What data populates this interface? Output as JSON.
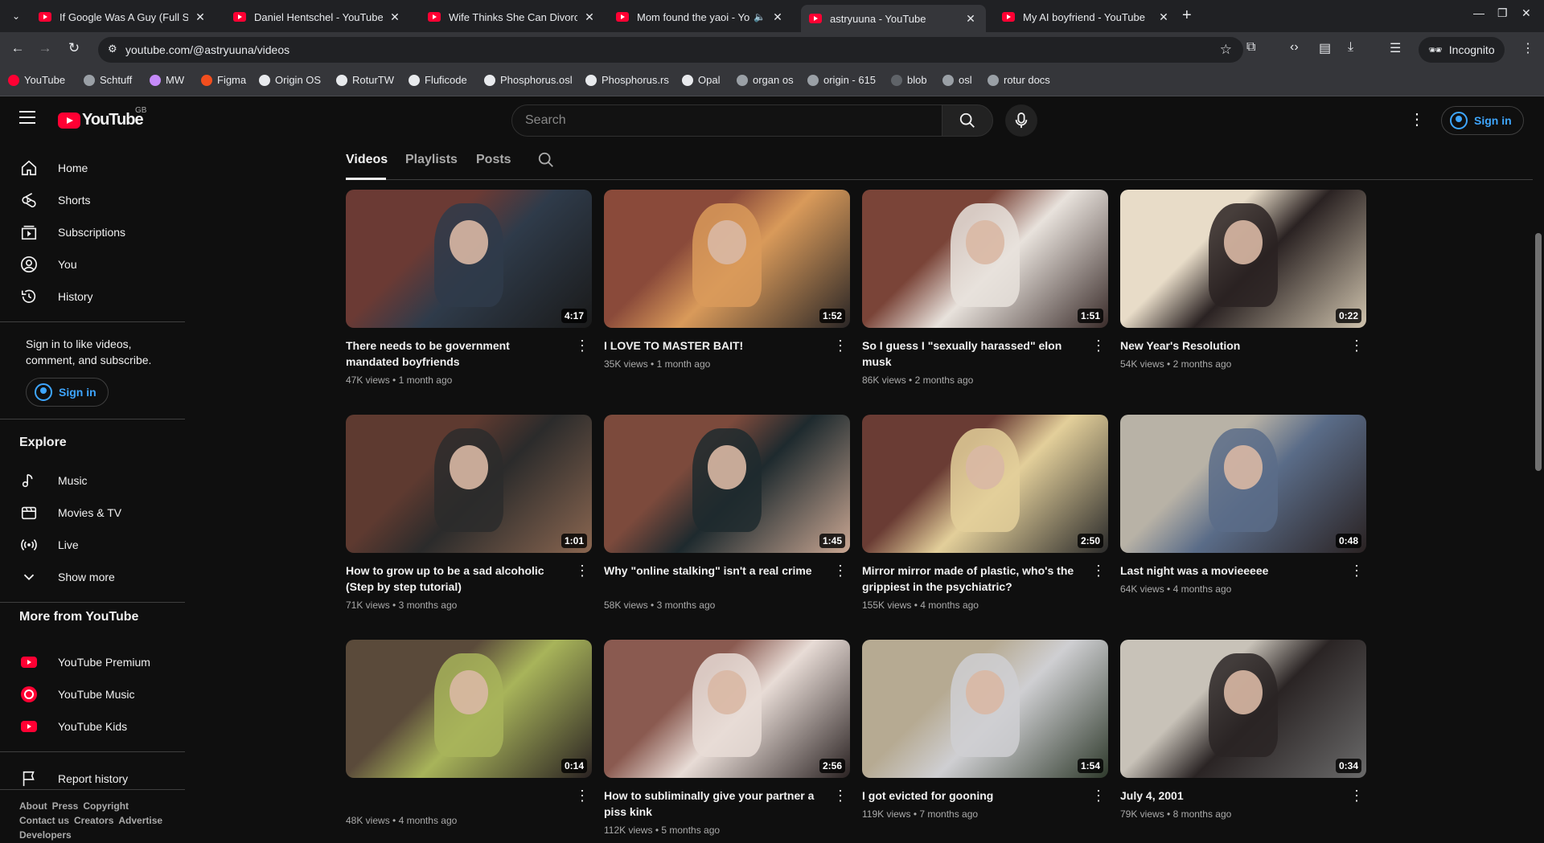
{
  "browser": {
    "tabs": [
      {
        "title": "If Google Was A Guy (Full Se",
        "active": false
      },
      {
        "title": "Daniel Hentschel - YouTube",
        "active": false
      },
      {
        "title": "Wife Thinks She Can Divorce",
        "active": false
      },
      {
        "title": "Mom found the yaoi - You",
        "active": false,
        "audio": "🔈"
      },
      {
        "title": "astryuuna - YouTube",
        "active": true
      },
      {
        "title": "My AI boyfriend - YouTube",
        "active": false
      }
    ],
    "tab_close": "✕",
    "new_tab": "+",
    "url": "youtube.com/@astryuuna/videos",
    "incognito_label": "Incognito",
    "bookmarks": [
      {
        "label": "YouTube",
        "color": "#ff0033"
      },
      {
        "label": "Schtuff",
        "color": "#9aa0a6"
      },
      {
        "label": "MW",
        "color": "#c58af9"
      },
      {
        "label": "Figma",
        "color": "#f24e1e"
      },
      {
        "label": "Origin OS",
        "color": "#e8eaed"
      },
      {
        "label": "RoturTW",
        "color": "#e8eaed"
      },
      {
        "label": "Fluficode",
        "color": "#e8eaed"
      },
      {
        "label": "Phosphorus.osl",
        "color": "#e8eaed"
      },
      {
        "label": "Phosphorus.rs",
        "color": "#e8eaed"
      },
      {
        "label": "Opal",
        "color": "#e8eaed"
      },
      {
        "label": "organ os",
        "color": "#9aa0a6"
      },
      {
        "label": "origin - 615",
        "color": "#9aa0a6"
      },
      {
        "label": "blob",
        "color": "#5f6368"
      },
      {
        "label": "osl",
        "color": "#9aa0a6"
      },
      {
        "label": "rotur docs",
        "color": "#9aa0a6"
      }
    ]
  },
  "youtube": {
    "logo_text": "YouTube",
    "region": "GB",
    "search_placeholder": "Search",
    "signin_label": "Sign in",
    "sidebar": {
      "main": [
        "Home",
        "Shorts",
        "Subscriptions",
        "You",
        "History"
      ],
      "signin_message": "Sign in to like videos, comment, and subscribe.",
      "signin_label": "Sign in",
      "explore_heading": "Explore",
      "explore": [
        "Music",
        "Movies & TV",
        "Live",
        "Show more"
      ],
      "more_heading": "More from YouTube",
      "more": [
        "YouTube Premium",
        "YouTube Music",
        "YouTube Kids"
      ],
      "report": "Report history",
      "footer1": [
        "About",
        "Press",
        "Copyright"
      ],
      "footer2": [
        "Contact us",
        "Creators",
        "Advertise"
      ],
      "footer3": [
        "Developers"
      ]
    },
    "channel_tabs": [
      "Videos",
      "Playlists",
      "Posts"
    ],
    "videos": [
      {
        "title": "There needs to be government mandated boyfriends",
        "views": "47K views",
        "age": "1 month ago",
        "duration": "4:17",
        "colors": [
          "#6b3a34",
          "#2f3b4a",
          "#1a1a1a"
        ]
      },
      {
        "title": "I LOVE TO MASTER BAIT!",
        "views": "35K views",
        "age": "1 month ago",
        "duration": "1:52",
        "colors": [
          "#8a4a3a",
          "#d99a5a",
          "#2a2626"
        ]
      },
      {
        "title": "So I guess I \"sexually harassed\" elon musk",
        "views": "86K views",
        "age": "2 months ago",
        "duration": "1:51",
        "colors": [
          "#7a4438",
          "#e8e2dc",
          "#3a2c2a"
        ]
      },
      {
        "title": "New Year's Resolution",
        "views": "54K views",
        "age": "2 months ago",
        "duration": "0:22",
        "colors": [
          "#e8dcc8",
          "#2a2222",
          "#cfc3ad"
        ]
      },
      {
        "title": "How to grow up to be a sad alcoholic (Step by step tutorial)",
        "views": "71K views",
        "age": "3 months ago",
        "duration": "1:01",
        "colors": [
          "#5e3a30",
          "#2b2b2b",
          "#8a6650"
        ]
      },
      {
        "title": "Why \"online stalking\" isn't a real crime",
        "views": "58K views",
        "age": "3 months ago",
        "duration": "1:45",
        "colors": [
          "#7c4a3c",
          "#1e2a2e",
          "#c9a692"
        ]
      },
      {
        "title": "Mirror mirror made of plastic, who's the grippiest in the psychiatric?",
        "views": "155K views",
        "age": "4 months ago",
        "duration": "2:50",
        "colors": [
          "#6a3c34",
          "#e3cf9a",
          "#2a2a2a"
        ]
      },
      {
        "title": "Last night was a movieeeee",
        "views": "64K views",
        "age": "4 months ago",
        "duration": "0:48",
        "colors": [
          "#b8b2a6",
          "#5a6c88",
          "#2a2222"
        ]
      },
      {
        "title": "",
        "views": "48K views",
        "age": "4 months ago",
        "duration": "0:14",
        "colors": [
          "#5a4a3a",
          "#a8b45a",
          "#2a2222"
        ]
      },
      {
        "title": "How to subliminally give your partner a piss kink",
        "views": "112K views",
        "age": "5 months ago",
        "duration": "2:56",
        "colors": [
          "#8a5a50",
          "#e8dcd6",
          "#2a2222"
        ]
      },
      {
        "title": "I got evicted for gooning",
        "views": "119K views",
        "age": "7 months ago",
        "duration": "1:54",
        "colors": [
          "#b6aa92",
          "#cfcfd2",
          "#2f3a2c"
        ]
      },
      {
        "title": "July 4, 2001",
        "views": "79K views",
        "age": "8 months ago",
        "duration": "0:34",
        "colors": [
          "#c8c2b8",
          "#2a2424",
          "#6a6a6a"
        ]
      }
    ]
  }
}
